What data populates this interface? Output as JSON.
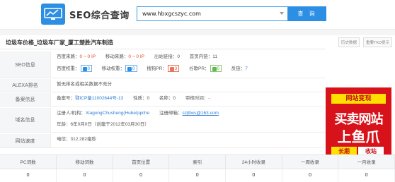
{
  "header": {
    "brand": "SEO综合查询",
    "search_value": "www.hbxgcszyc.com",
    "search_button": "查 询"
  },
  "page": {
    "title": "垃圾车价格_垃圾车厂家_厦工楚胜汽车制造",
    "history_btn": "历史数据",
    "tkd_btn": "重要TKD提示"
  },
  "seo": {
    "label": "SEO信息",
    "baidu_traffic_label": "百度来路：",
    "baidu_traffic": "0 ~ 0 IP",
    "mobile_traffic_label": "移动来路：",
    "mobile_traffic": "0 ~ 0 IP",
    "outlinks_label": "出站链接：",
    "outlinks": "0",
    "inner_links_label": "首页内链：",
    "inner_links": "11",
    "baidu_weight_label": "百度权重：",
    "baidu_weight": "0",
    "mobile_weight_label": "移动权重：",
    "mobile_weight": "0",
    "sogou_pr_label": "搜狗PR：",
    "sogou_pr": "3",
    "google_pr_label": "谷歌PR：",
    "google_pr": "0",
    "backlinks_label": "反链：",
    "backlinks": "7"
  },
  "alexa": {
    "label": "ALEXA排名",
    "text": "暂无排名或相关数据不充分"
  },
  "icp": {
    "label": "备案信息",
    "number_label": "备案号：",
    "number": "鄂ICP备11002644号-13",
    "nature_label": "性质：",
    "nature": "0",
    "name_label": "名称：",
    "name": "0",
    "review_label": "审核时间：",
    "review": "-"
  },
  "domain": {
    "label": "域名信息",
    "registrant_label": "注册人/机构：",
    "registrant": "XiagongChusheng(Hubei)qiche",
    "email_label": "注册邮箱：",
    "email": "szjtbxs@163.com",
    "age_label": "年龄：",
    "age": "6年0月0日",
    "created": "（创建于2012年03月30日）"
  },
  "speed": {
    "label": "网站速度",
    "text": "电信：312.282毫秒"
  },
  "ad": {
    "top": "网站变现",
    "line1": "买卖网站",
    "line2": "上鱼爪",
    "tag1": "长期",
    "tag2": "收站"
  },
  "stats": {
    "headers": [
      "PC词数",
      "移动词数",
      "首页位置",
      "索引",
      "24小时收录",
      "一周收录",
      "一月收录"
    ],
    "values": [
      "0",
      "0",
      "0",
      "0",
      "0",
      "0",
      "0"
    ]
  },
  "colors": {
    "accent": "#2d8fe3",
    "red": "#e24a2b",
    "ad_red": "#d8121a",
    "ad_yellow": "#ffe000"
  }
}
